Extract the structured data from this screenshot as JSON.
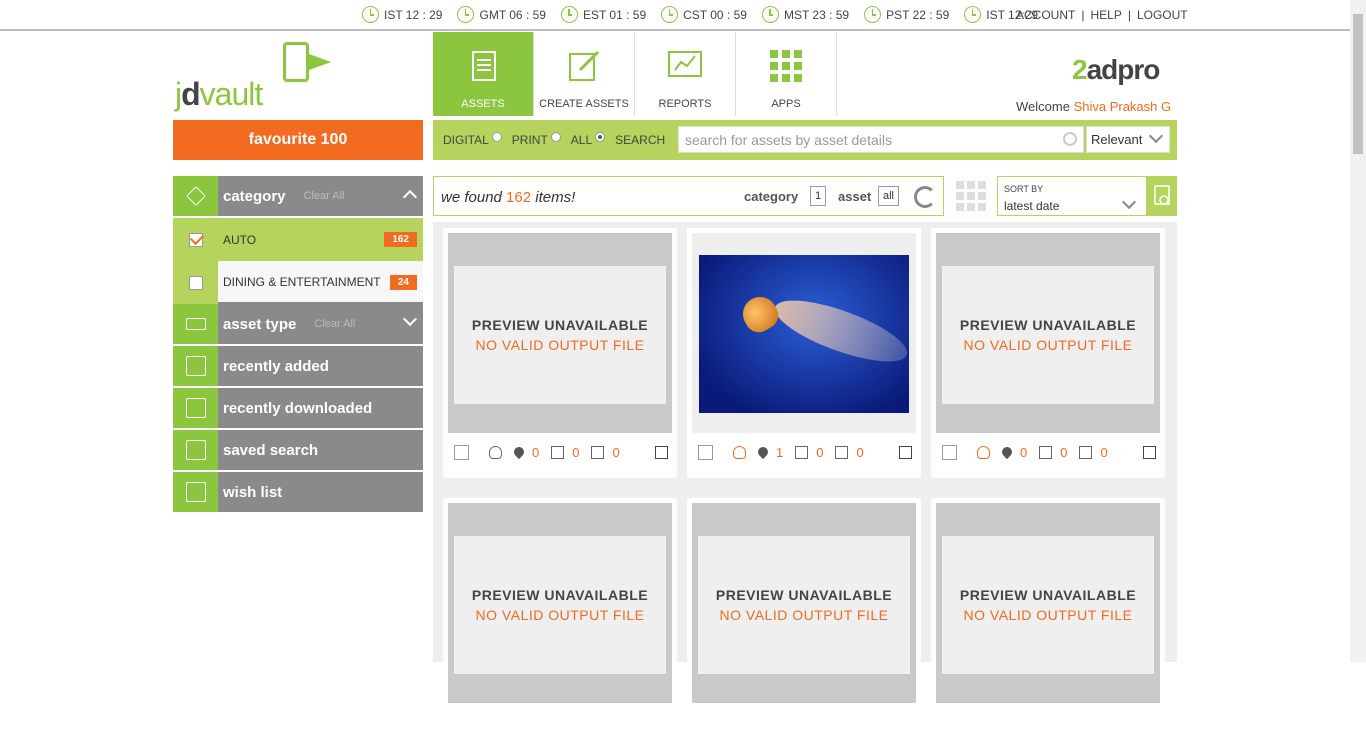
{
  "clocks": [
    {
      "label": "IST 12 : 29"
    },
    {
      "label": "GMT 06 : 59"
    },
    {
      "label": "EST 01 : 59"
    },
    {
      "label": "CST 00 : 59"
    },
    {
      "label": "MST 23 : 59"
    },
    {
      "label": "PST 22 : 59"
    },
    {
      "label": "IST 12:29"
    }
  ],
  "toplinks": {
    "account": "ACCOUNT",
    "help": "HELP",
    "logout": "LOGOUT",
    "sep": "|"
  },
  "logo": {
    "prefix": "j",
    "dark": "d",
    "rest": "vault"
  },
  "favourite": "favourite 100",
  "nav": [
    {
      "label": "ASSETS",
      "icon": "document-icon"
    },
    {
      "label": "CREATE ASSETS",
      "icon": "edit-icon"
    },
    {
      "label": "REPORTS",
      "icon": "chart-icon"
    },
    {
      "label": "APPS",
      "icon": "apps-grid-icon"
    }
  ],
  "brand": {
    "num": "2",
    "text": "adpro"
  },
  "welcome": {
    "prefix": "Welcome ",
    "name": "Shiva Prakash G"
  },
  "filters": {
    "digital": "DIGITAL",
    "print": "PRINT",
    "all": "ALL",
    "search": "SEARCH",
    "search_placeholder": "search for assets by asset details",
    "relevant": "Relevant"
  },
  "sidebar": {
    "category": {
      "label": "category",
      "clear": "Clear All"
    },
    "items": [
      {
        "label": "AUTO",
        "count": "162",
        "checked": true
      },
      {
        "label": "DINING & ENTERTAINMENT",
        "count": "24",
        "checked": false
      }
    ],
    "asset_type": {
      "label": "asset type",
      "clear": "Clear All"
    },
    "recently_added": "recently added",
    "recently_downloaded": "recently downloaded",
    "saved_search": "saved search",
    "wish_list": "wish list"
  },
  "results": {
    "found_prefix": "we found ",
    "count": "162",
    "found_suffix": " items!",
    "category_label": "category",
    "category_count": "1",
    "asset_label": "asset",
    "asset_count": "all"
  },
  "sort": {
    "label": "SORT BY",
    "value": "latest date"
  },
  "cards": [
    {
      "preview": "PREVIEW UNAVAILABLE",
      "error": "NO VALID OUTPUT FILE",
      "likes": "0",
      "up": "0",
      "down": "0"
    },
    {
      "preview": "",
      "error": "",
      "likes": "1",
      "up": "0",
      "down": "0"
    },
    {
      "preview": "PREVIEW UNAVAILABLE",
      "error": "NO VALID OUTPUT FILE",
      "likes": "0",
      "up": "0",
      "down": "0"
    },
    {
      "preview": "PREVIEW UNAVAILABLE",
      "error": "NO VALID OUTPUT FILE"
    },
    {
      "preview": "PREVIEW UNAVAILABLE",
      "error": "NO VALID OUTPUT FILE"
    },
    {
      "preview": "PREVIEW UNAVAILABLE",
      "error": "NO VALID OUTPUT FILE"
    }
  ],
  "colors": {
    "accent": "#8cc63f",
    "orange": "#f26b21",
    "grey": "#8a8a8a"
  }
}
